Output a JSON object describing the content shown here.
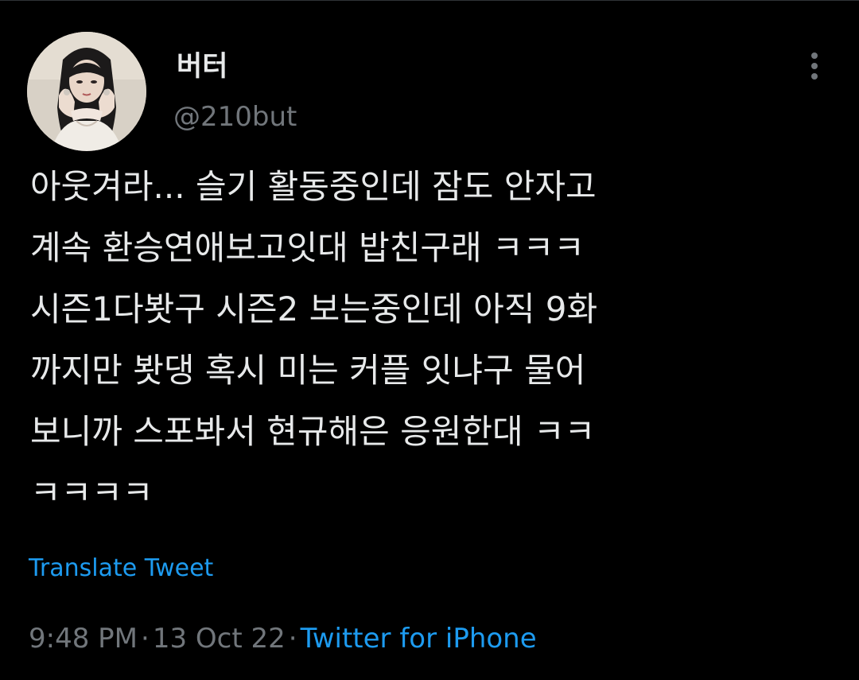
{
  "tweet": {
    "author": {
      "display_name": "버터",
      "handle": "@210but",
      "avatar_icon": "profile-photo-avatar"
    },
    "text_lines": [
      "아웃겨라... 슬기 활동중인데 잠도 안자고",
      "계속 환승연애보고잇대 밥친구래 ㅋㅋㅋ",
      "시즌1다봣구 시즌2 보는중인데 아직 9화",
      "까지만 봣댕 혹시 미는 커플 잇냐구 물어",
      "보니까 스포봐서 현규해은 응원한대 ㅋㅋ",
      "ㅋㅋㅋㅋ"
    ],
    "translate_label": "Translate Tweet",
    "time": "9:48 PM",
    "date": "13 Oct 22",
    "source": "Twitter for iPhone",
    "separator": "·",
    "more_icon": "more-vertical-icon"
  },
  "colors": {
    "background": "#000000",
    "text_primary": "#e7e9ea",
    "text_secondary": "#71767b",
    "accent": "#1d9bf0"
  }
}
